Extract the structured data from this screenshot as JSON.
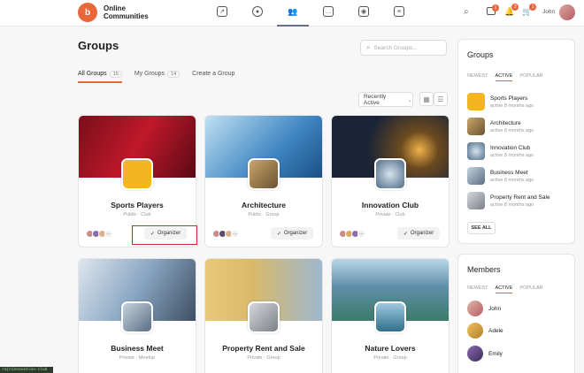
{
  "header": {
    "brand_line1": "Online",
    "brand_line2": "Communities",
    "logo_text": "b",
    "user_name": "John",
    "badges": {
      "messages": "1",
      "notifications": "3",
      "cart": "1"
    }
  },
  "main": {
    "title": "Groups",
    "search_placeholder": "Search Groups...",
    "tabs": [
      {
        "label": "All Groups",
        "count": "15"
      },
      {
        "label": "My Groups",
        "count": "14"
      },
      {
        "label": "Create a Group"
      }
    ],
    "sort_value": "Recently Active",
    "cards": [
      {
        "title": "Sports Players",
        "meta": "Public · Club",
        "button": "Organizer"
      },
      {
        "title": "Architecture",
        "meta": "Public · Group",
        "button": "Organizer"
      },
      {
        "title": "Innovation Club",
        "meta": "Private · Club",
        "button": "Organizer"
      },
      {
        "title": "Business Meet",
        "meta": "Private · Meetup"
      },
      {
        "title": "Property Rent and Sale",
        "meta": "Private · Group"
      },
      {
        "title": "Nature Lovers",
        "meta": "Private · Group"
      }
    ],
    "more_members": "···"
  },
  "sidebar": {
    "groups": {
      "title": "Groups",
      "tabs": [
        "NEWEST",
        "ACTIVE",
        "POPULAR"
      ],
      "items": [
        {
          "name": "Sports Players",
          "time": "active 8 months ago"
        },
        {
          "name": "Architecture",
          "time": "active 8 months ago"
        },
        {
          "name": "Innovation Club",
          "time": "active 8 months ago"
        },
        {
          "name": "Business Meet",
          "time": "active 8 months ago"
        },
        {
          "name": "Property Rent and Sale",
          "time": "active 8 months ago"
        }
      ],
      "see_all": "SEE ALL"
    },
    "members": {
      "title": "Members",
      "tabs": [
        "NEWEST",
        "ACTIVE",
        "POPULAR"
      ],
      "items": [
        "John",
        "Adele",
        "Emily"
      ]
    }
  },
  "toast": "rajninnovation-club",
  "colors": {
    "accent": "#e9653a",
    "highlight": "#d9262b"
  }
}
